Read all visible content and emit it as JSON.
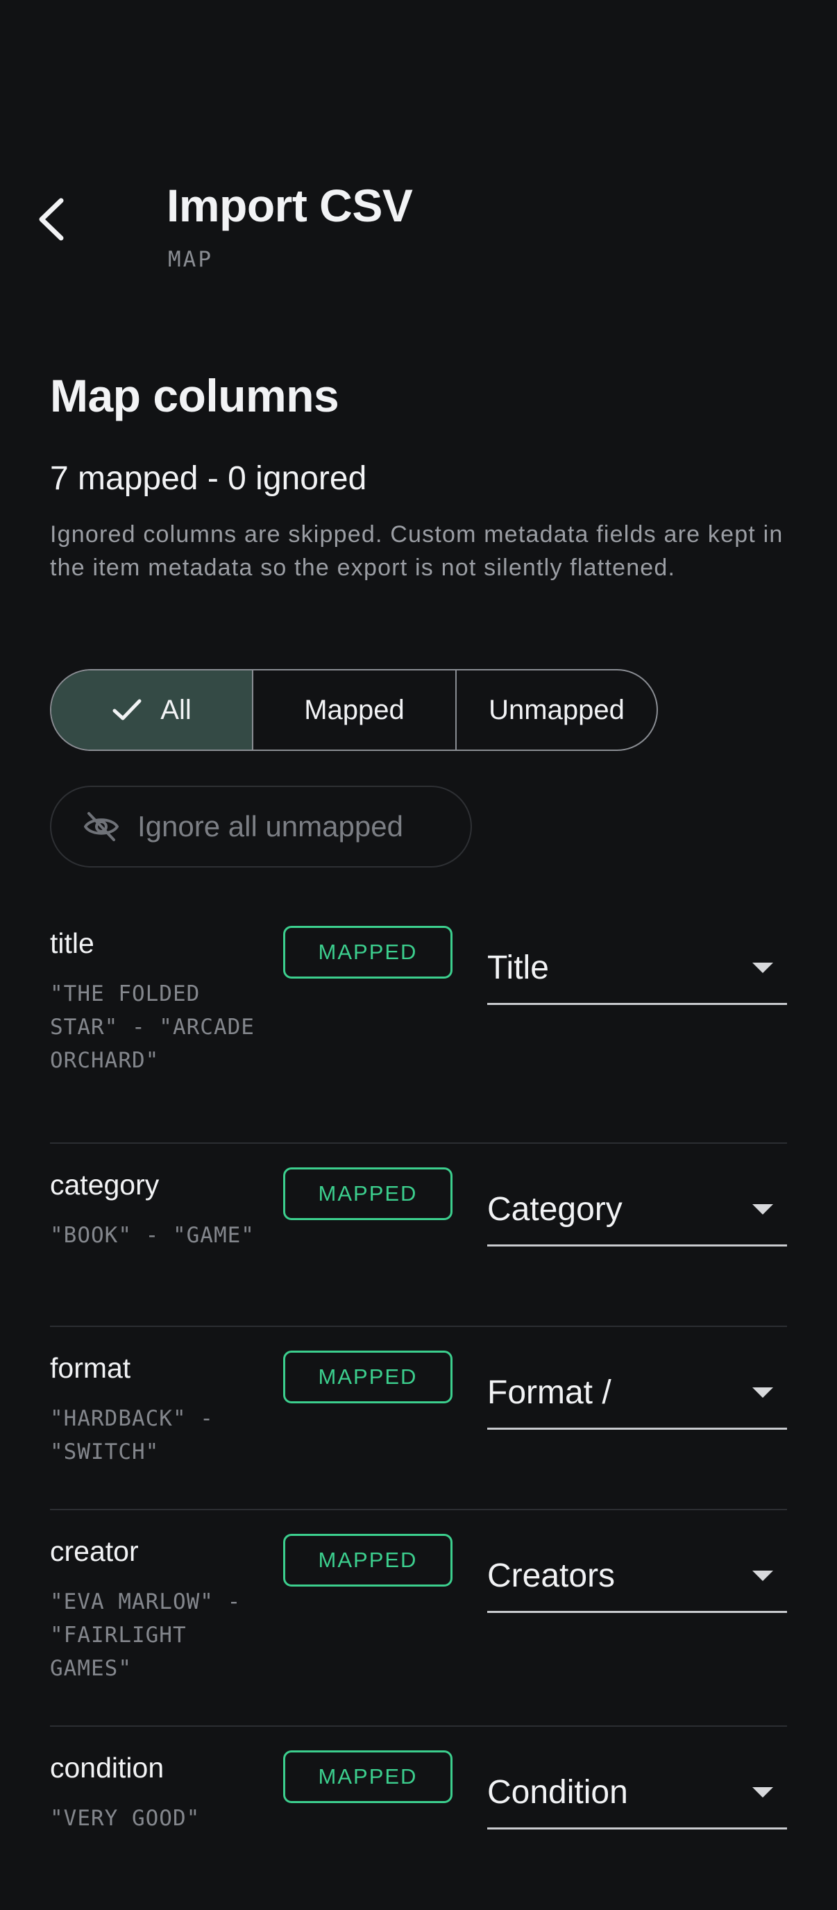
{
  "header": {
    "title": "Import CSV",
    "step": "MAP"
  },
  "section": {
    "heading": "Map columns",
    "summary": "7 mapped - 0 ignored",
    "help": "Ignored columns are skipped. Custom metadata fields are kept in the item metadata so the export is not silently flattened."
  },
  "filters": {
    "selected": "All",
    "options": [
      "All",
      "Mapped",
      "Unmapped"
    ]
  },
  "ignore_button": {
    "label": "Ignore all unmapped",
    "icon": "eye-off-icon"
  },
  "columns": [
    {
      "name": "title",
      "sample": "\"THE FOLDED STAR\" - \"ARCADE ORCHARD\"",
      "status": "MAPPED",
      "field": "Title"
    },
    {
      "name": "category",
      "sample": "\"BOOK\" - \"GAME\"",
      "status": "MAPPED",
      "field": "Category"
    },
    {
      "name": "format",
      "sample": "\"HARDBACK\" - \"SWITCH\"",
      "status": "MAPPED",
      "field": "Format /"
    },
    {
      "name": "creator",
      "sample": "\"EVA MARLOW\" - \"FAIRLIGHT GAMES\"",
      "status": "MAPPED",
      "field": "Creators"
    },
    {
      "name": "condition",
      "sample": "\"VERY GOOD\"",
      "status": "MAPPED",
      "field": "Condition"
    }
  ],
  "colors": {
    "background": "#111214",
    "accent_green": "#3ccf8e",
    "selected_segment": "#344a45"
  }
}
